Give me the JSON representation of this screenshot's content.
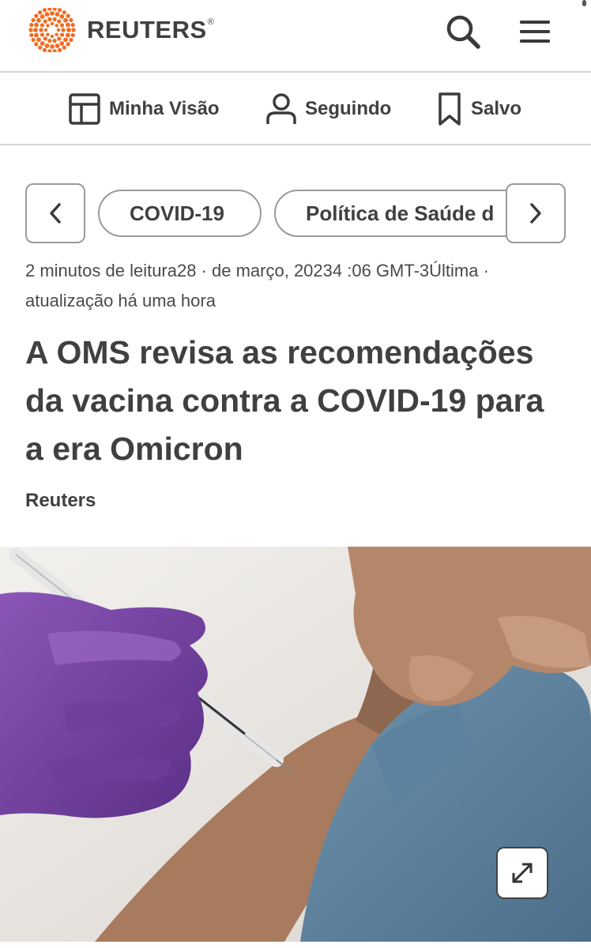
{
  "header": {
    "brand": "REUTERS",
    "registered_mark": "®",
    "logo_icon": "reuters-dot-logo-icon",
    "search_icon": "search-icon",
    "menu_icon": "hamburger-menu-icon",
    "accent_color": "#f26b21"
  },
  "subnav": {
    "items": [
      {
        "label": "Minha Visão",
        "icon": "dashboard-icon"
      },
      {
        "label": "Seguindo",
        "icon": "person-icon"
      },
      {
        "label": "Salvo",
        "icon": "bookmark-icon"
      }
    ]
  },
  "tags": {
    "items": [
      "COVID-19",
      "Política de Saúde d"
    ],
    "prev_icon": "chevron-left-icon",
    "next_icon": "chevron-right-icon"
  },
  "article": {
    "meta": "2 minutos de leitura28 · de março, 20234 :06 GMT-3Última · atualização há uma hora",
    "headline": "A OMS revisa as recomendações da vacina contra a COVID-19 para a era Omicron",
    "byline": "Reuters",
    "expand_icon": "expand-arrows-icon"
  }
}
